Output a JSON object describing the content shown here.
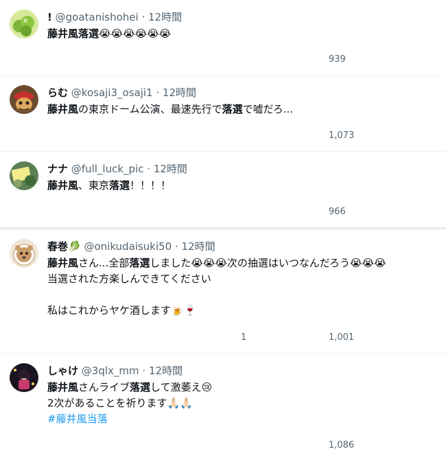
{
  "tweets": [
    {
      "display_name": "!",
      "handle": "@goatanishohei",
      "dot": "·",
      "time": "12時間",
      "lines": [
        [
          {
            "b": true,
            "t": "藤井風落選"
          },
          {
            "t": "😭😭😭😭😭😭"
          }
        ]
      ],
      "stats": {
        "replies": "",
        "retweets": "",
        "likes": "",
        "views": "939"
      }
    },
    {
      "display_name": "らむ",
      "handle": "@kosaji3_osaji1",
      "dot": "·",
      "time": "12時間",
      "lines": [
        [
          {
            "b": true,
            "t": "藤井風"
          },
          {
            "t": "の東京ドーム公演、最速先行で"
          },
          {
            "b": true,
            "t": "落選"
          },
          {
            "t": "で嘘だろ..."
          }
        ]
      ],
      "stats": {
        "replies": "",
        "retweets": "",
        "likes": "",
        "views": "1,073"
      }
    },
    {
      "display_name": "ナナ",
      "handle": "@full_luck_pic",
      "dot": "·",
      "time": "12時間",
      "lines": [
        [
          {
            "b": true,
            "t": "藤井風"
          },
          {
            "t": "、東京"
          },
          {
            "b": true,
            "t": "落選"
          },
          {
            "t": "！！！！"
          }
        ]
      ],
      "stats": {
        "replies": "",
        "retweets": "",
        "likes": "",
        "views": "966"
      }
    },
    {
      "display_name": "春巻🥬",
      "handle": "@onikudaisuki50",
      "dot": "·",
      "time": "12時間",
      "lines": [
        [
          {
            "b": true,
            "t": "藤井風"
          },
          {
            "t": "さん...全部"
          },
          {
            "b": true,
            "t": "落選"
          },
          {
            "t": "しました😭😭😭次の抽選はいつなんだろう😭😭😭"
          }
        ],
        [
          {
            "t": "当選された方楽しんできてください"
          }
        ],
        [],
        [
          {
            "t": "私はこれからヤケ酒します🍺🍷"
          }
        ]
      ],
      "stats": {
        "replies": "",
        "retweets": "",
        "likes": "1",
        "views": "1,001"
      }
    },
    {
      "display_name": "しゃけ",
      "handle": "@3qlx_mm",
      "dot": "·",
      "time": "12時間",
      "lines": [
        [
          {
            "b": true,
            "t": "藤井風"
          },
          {
            "t": "さんライブ"
          },
          {
            "b": true,
            "t": "落選"
          },
          {
            "t": "して激萎え😢"
          }
        ],
        [
          {
            "t": "2次があることを祈ります🙏🏻🙏🏻"
          }
        ],
        [
          {
            "h": true,
            "t": " #藤井風当落"
          }
        ]
      ],
      "stats": {
        "replies": "",
        "retweets": "",
        "likes": "",
        "views": "1,086"
      }
    }
  ],
  "icons": {
    "avatar": "avatar-image",
    "grok": "grok-icon",
    "more": "more-options-icon",
    "reply": "reply-icon",
    "retweet": "retweet-icon",
    "like": "like-icon",
    "views": "views-icon",
    "bookmark": "bookmark-icon",
    "share": "share-icon"
  },
  "colors": {
    "text": "#0f1419",
    "secondary": "#536471",
    "link": "#1d9bf0",
    "divider": "#eff3f4"
  }
}
